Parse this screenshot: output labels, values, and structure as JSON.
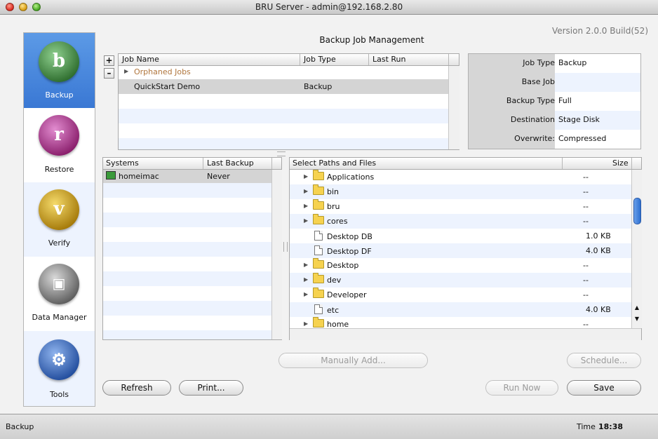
{
  "window": {
    "title": "BRU Server - admin@192.168.2.80"
  },
  "version": "Version 2.0.0 Build(52)",
  "page_title": "Backup Job Management",
  "sidebar": {
    "items": [
      {
        "label": "Backup",
        "icon": "backup-icon",
        "glyph": "b",
        "color": "#3c7a3c"
      },
      {
        "label": "Restore",
        "icon": "restore-icon",
        "glyph": "r",
        "color": "#9c2f7e"
      },
      {
        "label": "Verify",
        "icon": "verify-icon",
        "glyph": "v",
        "color": "#c09a14"
      },
      {
        "label": "Data Manager",
        "icon": "data-manager-icon",
        "glyph": "",
        "color": "#6f6f6f"
      },
      {
        "label": "Tools",
        "icon": "tools-icon",
        "glyph": "",
        "color": "#2f5aa8"
      }
    ]
  },
  "jobs": {
    "add_label": "+",
    "remove_label": "–",
    "columns": [
      "Job Name",
      "Job Type",
      "Last Run"
    ],
    "group": "Orphaned Jobs",
    "rows": [
      {
        "name": "QuickStart Demo",
        "type": "Backup",
        "last_run": ""
      }
    ]
  },
  "properties": [
    {
      "label": "Job Type",
      "value": "Backup"
    },
    {
      "label": "Base Job",
      "value": ""
    },
    {
      "label": "Backup Type",
      "value": "Full"
    },
    {
      "label": "Destination",
      "value": "Stage Disk"
    },
    {
      "label": "Overwrite:",
      "value": "Compressed"
    }
  ],
  "systems": {
    "columns": [
      "Systems",
      "Last Backup"
    ],
    "rows": [
      {
        "name": "homeimac",
        "last_backup": "Never"
      }
    ]
  },
  "files": {
    "columns": [
      "Select Paths and Files",
      "Size"
    ],
    "rows": [
      {
        "name": "Applications",
        "kind": "folder",
        "size": "--"
      },
      {
        "name": "bin",
        "kind": "folder",
        "size": "--"
      },
      {
        "name": "bru",
        "kind": "folder",
        "size": "--"
      },
      {
        "name": "cores",
        "kind": "folder",
        "size": "--"
      },
      {
        "name": "Desktop DB",
        "kind": "file",
        "size": "1.0 KB"
      },
      {
        "name": "Desktop DF",
        "kind": "file",
        "size": "4.0 KB"
      },
      {
        "name": "Desktop",
        "kind": "folder",
        "size": "--"
      },
      {
        "name": "dev",
        "kind": "folder",
        "size": "--"
      },
      {
        "name": "Developer",
        "kind": "folder",
        "size": "--"
      },
      {
        "name": "etc",
        "kind": "file",
        "size": "4.0 KB"
      },
      {
        "name": "home",
        "kind": "folder",
        "size": "--"
      }
    ]
  },
  "buttons": {
    "manually_add": "Manually Add...",
    "schedule": "Schedule...",
    "refresh": "Refresh",
    "print": "Print...",
    "run_now": "Run Now",
    "save": "Save"
  },
  "status": {
    "left": "Backup",
    "time_label": "Time",
    "time_value": "18:38"
  }
}
